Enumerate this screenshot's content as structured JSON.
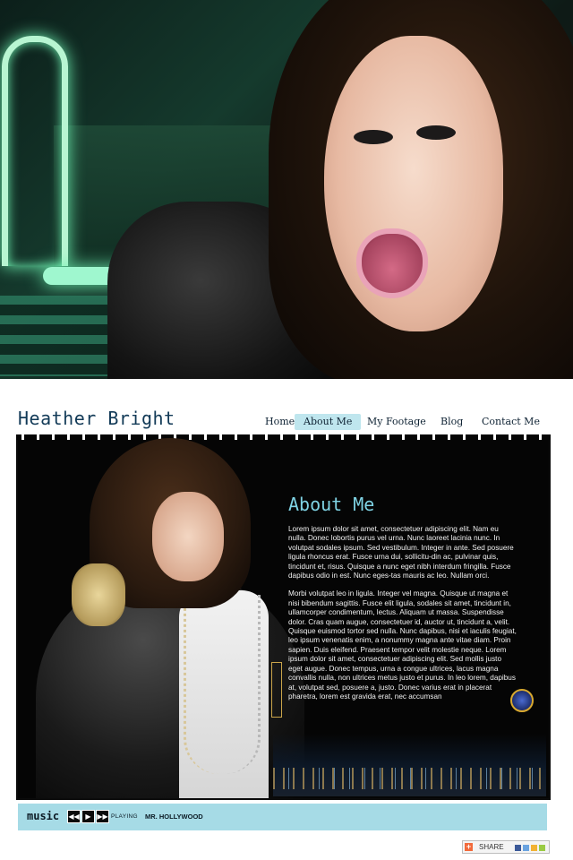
{
  "site": {
    "title": "Heather Bright"
  },
  "nav": [
    {
      "label": "Home"
    },
    {
      "label": "About Me",
      "active": true
    },
    {
      "label": "My Footage"
    },
    {
      "label": "Blog"
    },
    {
      "label": "Contact Me"
    }
  ],
  "about": {
    "title": "About Me",
    "paragraphs": [
      "Lorem ipsum dolor sit amet, consectetuer adipiscing elit. Nam eu nulla. Donec lobortis purus vel urna. Nunc laoreet lacinia nunc. In volutpat sodales ipsum. Sed vestibulum. Integer in ante. Sed posuere ligula rhoncus erat. Fusce urna dui, sollicitu-din ac, pulvinar quis, tincidunt et, risus. Quisque a nunc eget nibh interdum fringilla. Fusce dapibus odio in est. Nunc eges-tas mauris ac leo. Nullam orci.",
      "Morbi volutpat leo in ligula. Integer vel magna. Quisque ut magna et nisi bibendum sagittis. Fusce elit ligula, sodales sit amet, tincidunt in, ullamcorper condimentum, lectus. Aliquam ut massa. Suspendisse dolor. Cras quam augue, consectetuer id, auctor ut, tincidunt a, velit. Quisque euismod tortor sed nulla. Nunc dapibus, nisi et iaculis feugiat, leo ipsum venenatis enim, a nonummy magna ante vitae diam. Proin sapien. Duis eleifend. Praesent tempor velit molestie neque. Lorem ipsum dolor sit amet, consectetuer adipiscing elit. Sed mollis justo eget augue. Donec tempus, urna a congue ultrices, lacus magna convallis nulla, non ultrices metus justo et purus. In leo lorem, dapibus at, volutpat sed, posuere a, justo. Donec varius erat in placerat pharetra, lorem est gravida erat, nec accumsan"
    ]
  },
  "music": {
    "label": "music",
    "controls": {
      "rewind": "◀◀",
      "play": "▶",
      "forward": "▶▶"
    },
    "status": "PLAYING",
    "track": "MR. HOLLYWOOD"
  },
  "share": {
    "label": "SHARE",
    "plus": "+"
  },
  "colors": {
    "accent": "#7fd3e4",
    "music_bar": "#a6dbe6",
    "logo": "#123a57"
  }
}
